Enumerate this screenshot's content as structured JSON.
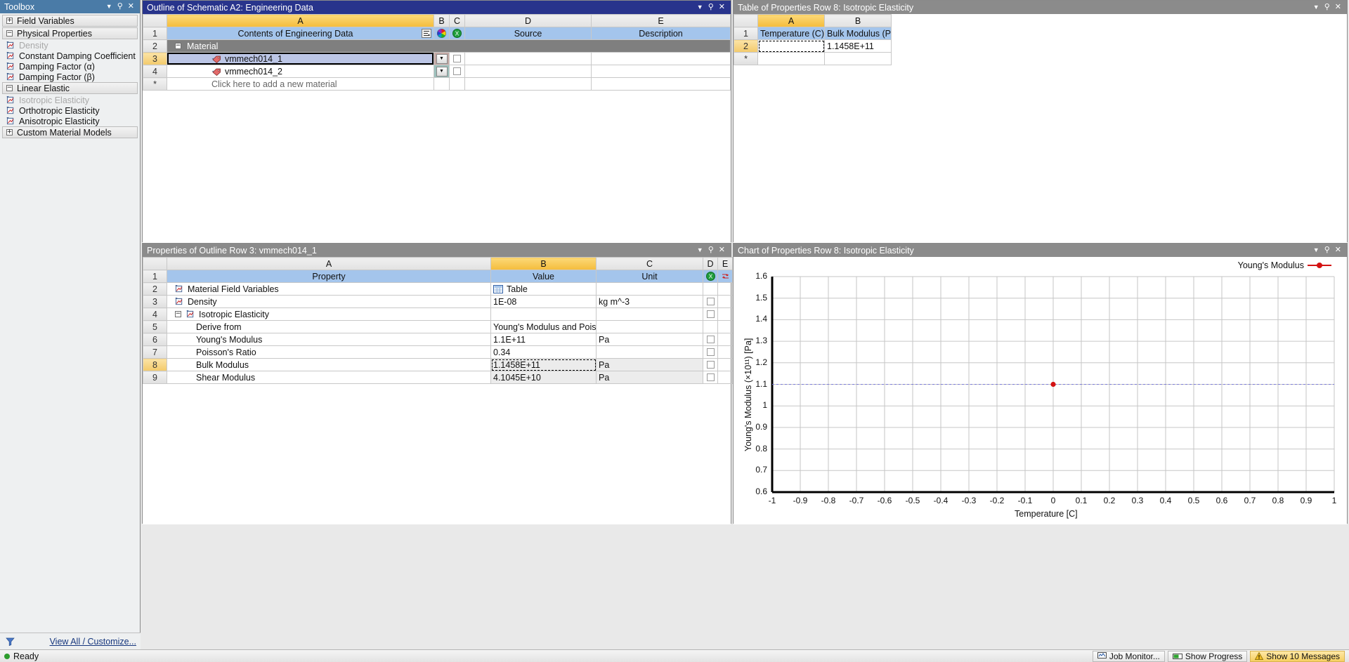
{
  "toolbox": {
    "title": "Toolbox",
    "groups": [
      {
        "label": "Field Variables",
        "expanded": false,
        "items": []
      },
      {
        "label": "Physical Properties",
        "expanded": true,
        "items": [
          {
            "label": "Density",
            "disabled": true
          },
          {
            "label": "Constant Damping Coefficient",
            "disabled": false
          },
          {
            "label": "Damping Factor (α)",
            "disabled": false
          },
          {
            "label": "Damping Factor (β)",
            "disabled": false
          }
        ]
      },
      {
        "label": "Linear Elastic",
        "expanded": true,
        "items": [
          {
            "label": "Isotropic Elasticity",
            "disabled": true
          },
          {
            "label": "Orthotropic Elasticity",
            "disabled": false
          },
          {
            "label": "Anisotropic Elasticity",
            "disabled": false
          }
        ]
      },
      {
        "label": "Custom Material Models",
        "expanded": false,
        "items": []
      }
    ],
    "footer_link": "View All / Customize..."
  },
  "outline": {
    "title": "Outline of Schematic A2: Engineering Data",
    "columns": [
      "A",
      "B",
      "C",
      "D",
      "E"
    ],
    "header_row": {
      "a": "Contents of Engineering Data",
      "d": "Source",
      "e": "Description"
    },
    "rows": [
      {
        "num": "2",
        "kind": "section",
        "label": "Material"
      },
      {
        "num": "3",
        "kind": "material",
        "label": "vmmech014_1",
        "selected": true,
        "swatch": "#c4a9a5"
      },
      {
        "num": "4",
        "kind": "material",
        "label": "vmmech014_2",
        "selected": false,
        "swatch": "#9dc0bc"
      },
      {
        "num": "*",
        "kind": "new",
        "label": "Click here to add a new material"
      }
    ]
  },
  "tableprops": {
    "title": "Table of Properties Row 8: Isotropic Elasticity",
    "columns": [
      "A",
      "B"
    ],
    "header_row": {
      "a": "Temperature (C)",
      "b": "Bulk Modulus (Pa)"
    },
    "rows": [
      {
        "num": "2",
        "a": "",
        "b": "1.1458E+11",
        "editing": true
      },
      {
        "num": "*",
        "a": "",
        "b": ""
      }
    ]
  },
  "properties": {
    "title": "Properties of Outline Row 3: vmmech014_1",
    "columns": [
      "A",
      "B",
      "C",
      "D",
      "E"
    ],
    "header_row": {
      "a": "Property",
      "b": "Value",
      "c": "Unit"
    },
    "rows": [
      {
        "num": "2",
        "property": "Material Field Variables",
        "value": "Table",
        "unit": "",
        "icon": "chart-icon",
        "value_icon": "table-icon",
        "indent": 0
      },
      {
        "num": "3",
        "property": "Density",
        "value": "1E-08",
        "unit": "kg m^-3",
        "icon": "chart-icon",
        "indent": 0,
        "has_d": true
      },
      {
        "num": "4",
        "property": "Isotropic Elasticity",
        "value": "",
        "unit": "",
        "icon": "chart-icon",
        "indent": 0,
        "expander": true,
        "has_d": true
      },
      {
        "num": "5",
        "property": "Derive from",
        "value": "Young's Modulus and Poisson…",
        "unit": "",
        "indent": 1,
        "dropdown": true
      },
      {
        "num": "6",
        "property": "Young's Modulus",
        "value": "1.1E+11",
        "unit": "Pa",
        "indent": 1,
        "has_d": true
      },
      {
        "num": "7",
        "property": "Poisson's Ratio",
        "value": "0.34",
        "unit": "",
        "indent": 1,
        "has_d": true
      },
      {
        "num": "8",
        "property": "Bulk Modulus",
        "value": "1.1458E+11",
        "unit": "Pa",
        "indent": 1,
        "selected": true,
        "grey": true,
        "has_d": true
      },
      {
        "num": "9",
        "property": "Shear Modulus",
        "value": "4.1045E+10",
        "unit": "Pa",
        "indent": 1,
        "grey": true,
        "has_d": true
      }
    ]
  },
  "chart": {
    "title": "Chart of Properties Row 8: Isotropic Elasticity"
  },
  "chart_data": {
    "type": "scatter",
    "title": "Chart of Properties Row 8: Isotropic Elasticity",
    "xlabel": "Temperature [C]",
    "ylabel": "Young's Modulus  (×10¹¹)  [Pa]",
    "xlim": [
      -1,
      1
    ],
    "ylim": [
      0.6,
      1.6
    ],
    "xticks": [
      "-1",
      "-0.9",
      "-0.8",
      "-0.7",
      "-0.6",
      "-0.5",
      "-0.4",
      "-0.3",
      "-0.2",
      "-0.1",
      "0",
      "0.1",
      "0.2",
      "0.3",
      "0.4",
      "0.5",
      "0.6",
      "0.7",
      "0.8",
      "0.9",
      "1"
    ],
    "yticks": [
      "1.6",
      "1.5",
      "1.4",
      "1.3",
      "1.2",
      "1.1",
      "1",
      "0.9",
      "0.8",
      "0.7",
      "0.6"
    ],
    "grid": true,
    "legend_position": "top-right",
    "series": [
      {
        "name": "Young's Modulus",
        "color": "#d41212",
        "x": [
          0
        ],
        "y": [
          1.1
        ],
        "reference_line_y": 1.1
      }
    ]
  },
  "statusbar": {
    "status": "Ready",
    "job_monitor": "Job Monitor...",
    "show_progress": "Show Progress",
    "messages": "Show 10 Messages"
  },
  "colors": {
    "title_active": "#28348c",
    "title_inactive": "#8b8b8b",
    "accent_header": "#f4bc3c",
    "blue_header": "#a4c5ec",
    "section_grey": "#7f7f7f",
    "selection_blue": "#bcc6e6",
    "series_red": "#d41212"
  }
}
